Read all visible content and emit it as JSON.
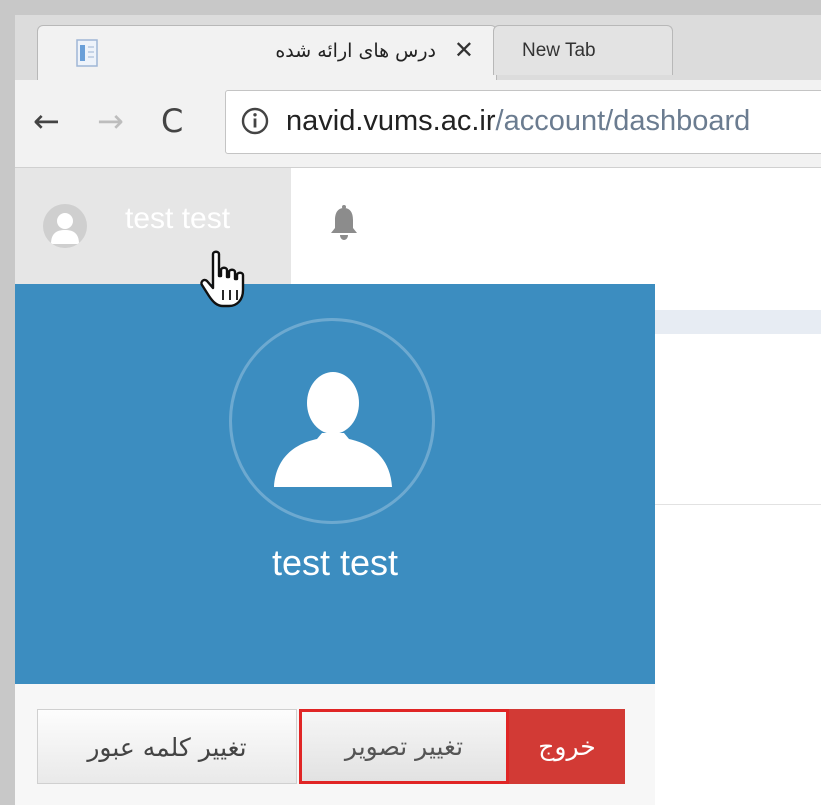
{
  "browser": {
    "tabs": [
      {
        "title": "درس های ارائه شده",
        "close": "✕",
        "active": true
      },
      {
        "title": "New Tab",
        "active": false
      }
    ],
    "nav": {
      "back": "←",
      "forward": "→",
      "reload": "C"
    },
    "url": {
      "host": "navid.vums.ac.ir",
      "path": "/account/dashboard"
    }
  },
  "header": {
    "user_name": "test test"
  },
  "dropdown": {
    "user_name": "test test",
    "buttons": {
      "change_password": "تغییر کلمه عبور",
      "change_image": "تغییر تصویر",
      "logout": "خروج"
    }
  },
  "colors": {
    "panel": "#3c8dc0",
    "logout": "#d23a35",
    "highlight": "#e02525"
  }
}
